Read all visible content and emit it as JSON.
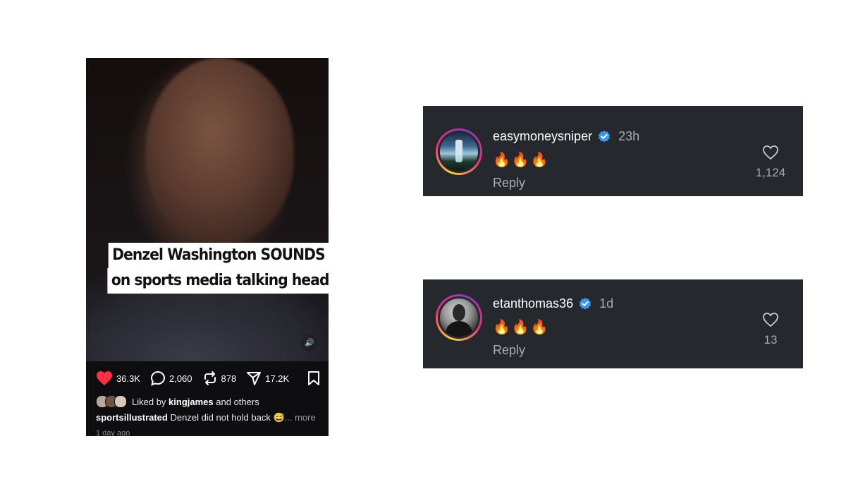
{
  "post": {
    "caption_overlay": {
      "line1": "Denzel Washington SOUNDS OFF",
      "line2": "on sports media talking heads"
    },
    "actions": {
      "likes": "36.3K",
      "comments": "2,060",
      "reposts": "878",
      "shares": "17.2K"
    },
    "liked_by": {
      "prefix": "Liked by",
      "user": "kingjames",
      "suffix": "and others"
    },
    "caption": {
      "username": "sportsillustrated",
      "text": "Denzel did not hold back 😅",
      "more": "... more"
    },
    "timestamp": "1 day ago",
    "colors": {
      "heart": "#ff3040",
      "background": "#0e0e10"
    }
  },
  "comments": [
    {
      "username": "easymoneysniper",
      "time": "23h",
      "text": "🔥🔥🔥",
      "reply_label": "Reply",
      "like_count": "1,124",
      "avatar": "waterfall-avatar"
    },
    {
      "username": "etanthomas36",
      "time": "1d",
      "text": "🔥🔥🔥",
      "reply_label": "Reply",
      "like_count": "13",
      "avatar": "portrait-avatar"
    }
  ],
  "theme": {
    "card_bg": "#25282d",
    "muted_text": "#a8acb3",
    "verified_blue": "#3897f0"
  }
}
